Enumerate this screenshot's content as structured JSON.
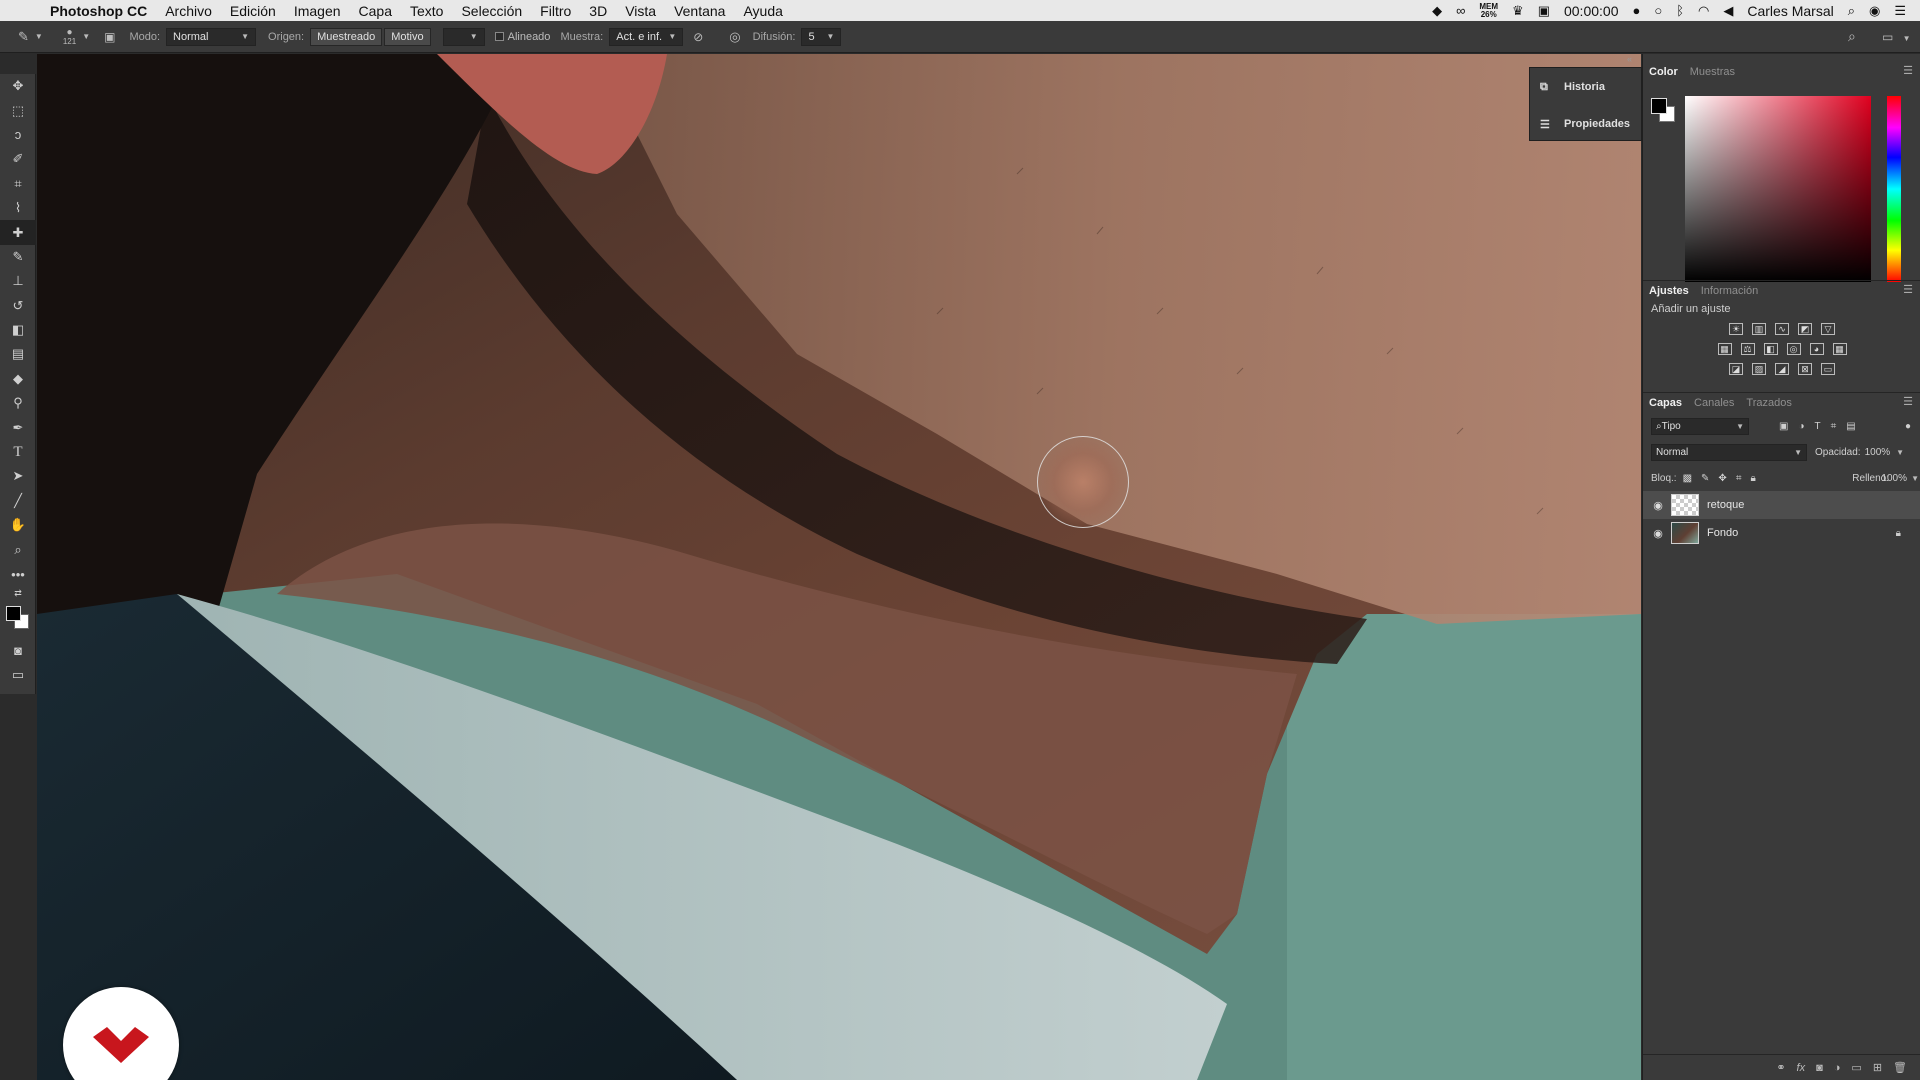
{
  "menubar": {
    "app_name": "Photoshop CC",
    "items": [
      "Archivo",
      "Edición",
      "Imagen",
      "Capa",
      "Texto",
      "Selección",
      "Filtro",
      "3D",
      "Vista",
      "Ventana",
      "Ayuda"
    ],
    "mem_label": "MEM",
    "mem_value": "26%",
    "clock": "00:00:00",
    "user": "Carles Marsal"
  },
  "options": {
    "brush_size": "121",
    "modo_label": "Modo:",
    "modo_value": "Normal",
    "origen_label": "Origen:",
    "origen_sampled": "Muestreado",
    "origen_pattern": "Motivo",
    "aligned_label": "Alineado",
    "muestra_label": "Muestra:",
    "muestra_value": "Act. e inf.",
    "difusion_label": "Difusión:",
    "difusion_value": "5"
  },
  "collapsed_panels": [
    "Historia",
    "Propiedades"
  ],
  "color_panel": {
    "tabs": [
      "Color",
      "Muestras"
    ],
    "foreground": "#000000",
    "background": "#ffffff",
    "hue": "#e0001f"
  },
  "adjustments_panel": {
    "tabs": [
      "Ajustes",
      "Información"
    ],
    "subtitle": "Añadir un ajuste"
  },
  "layers_panel": {
    "tabs": [
      "Capas",
      "Canales",
      "Trazados"
    ],
    "filter_kind": "Tipo",
    "blend_mode": "Normal",
    "opacity_label": "Opacidad:",
    "opacity_value": "100%",
    "lock_label": "Bloq.:",
    "fill_label": "Relleno:",
    "fill_value": "100%",
    "layers": [
      {
        "name": "retoque",
        "visible": true,
        "selected": true
      },
      {
        "name": "Fondo",
        "visible": true,
        "selected": false,
        "locked": true
      }
    ]
  }
}
